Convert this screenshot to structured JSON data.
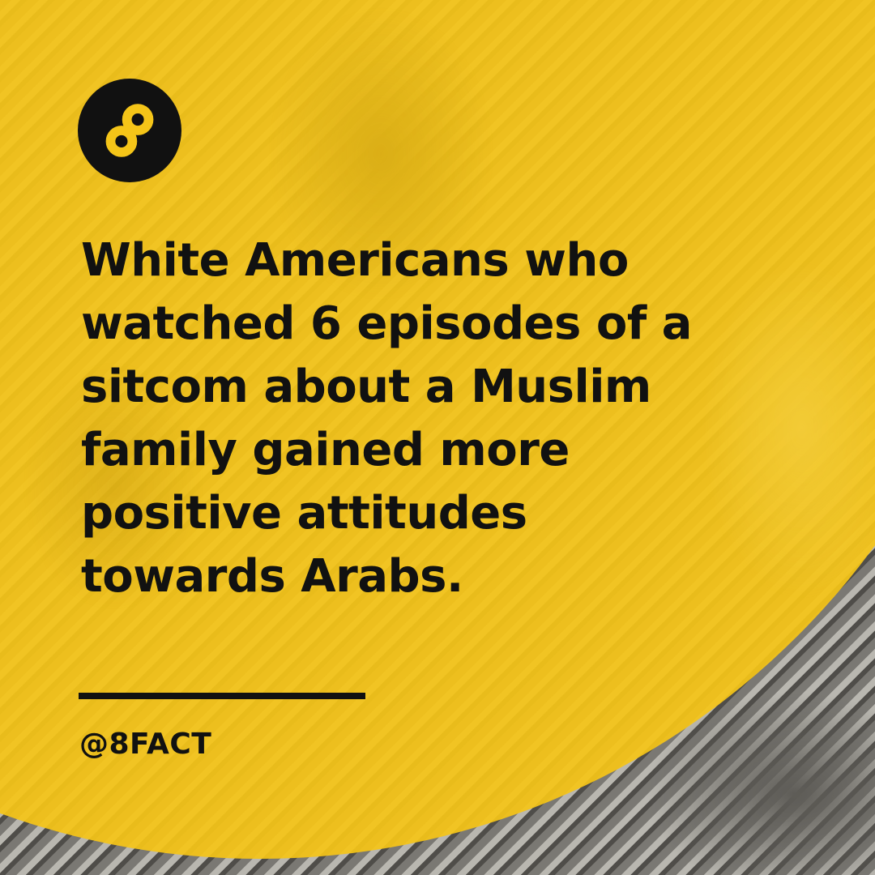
{
  "brand": {
    "logo_icon": "infinity-eight-icon",
    "logo_color": "#f5c518",
    "logo_bg": "#111111",
    "handle": "@8FACT"
  },
  "headline": {
    "lines": [
      "White Americans who",
      "watched 6 episodes of a",
      "sitcom about a Muslim",
      "family gained more",
      "positive attitudes",
      "towards Arabs."
    ]
  },
  "colors": {
    "accent": "#f5c518",
    "text": "#111111"
  }
}
